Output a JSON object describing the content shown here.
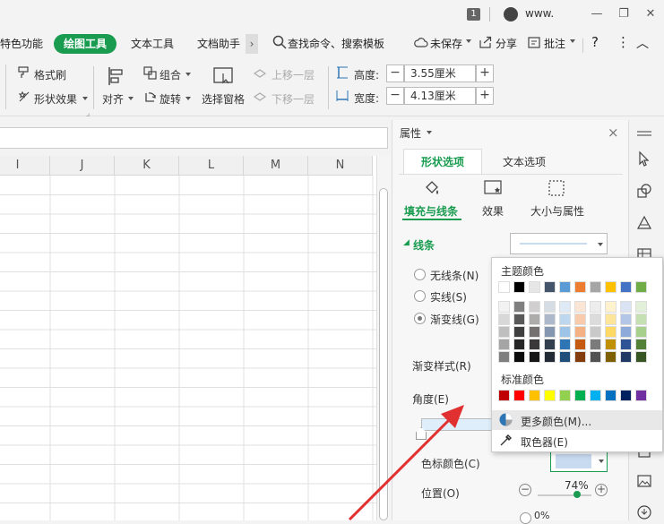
{
  "titlebar": {
    "badge": "1",
    "user": "www."
  },
  "window": {
    "minimize": "—",
    "restore": "❐",
    "close": "✕"
  },
  "menu": {
    "items": [
      "特色功能",
      "绘图工具",
      "文本工具",
      "文档助手"
    ],
    "more": "›",
    "search": "查找命令、搜索模板",
    "unsaved": "未保存",
    "share": "分享",
    "comment": "批注",
    "help": "?",
    "more_dots": "⋮",
    "collapse": "︿"
  },
  "ribbon": {
    "format_painter": "格式刷",
    "shape_effects": "形状效果",
    "align": "对齐",
    "group": "组合",
    "rotate": "旋转",
    "selection_pane": "选择窗格",
    "bring_forward": "上移一层",
    "send_backward": "下移一层",
    "height_label": "高度:",
    "height_value": "3.55厘米",
    "width_label": "宽度:",
    "width_value": "4.13厘米",
    "minus": "−",
    "plus": "+"
  },
  "sheet": {
    "columns": [
      "I",
      "J",
      "K",
      "L",
      "M",
      "N"
    ]
  },
  "panel": {
    "title": "属性",
    "close": "×",
    "tabs": [
      "形状选项",
      "文本选项"
    ],
    "subtabs": [
      "填充与线条",
      "效果",
      "大小与属性"
    ],
    "section": "线条",
    "line_options": [
      "无线条(N)",
      "实线(S)",
      "渐变线(G)"
    ],
    "gradient_style": "渐变样式(R)",
    "angle": "角度(E)",
    "stop_color": "色标颜色(C)",
    "position": "位置(O)",
    "position_value": "74%",
    "transparency_value": "0%"
  },
  "popup": {
    "theme_title": "主题颜色",
    "standard_title": "标准颜色",
    "more_colors": "更多颜色(M)...",
    "eyedropper": "取色器(E)",
    "theme_top": [
      "#ffffff",
      "#000000",
      "#e7e6e6",
      "#44546a",
      "#5b9bd5",
      "#ed7d31",
      "#a5a5a5",
      "#ffc000",
      "#4472c4",
      "#70ad47"
    ],
    "theme_shades": [
      [
        "#f2f2f2",
        "#7f7f7f",
        "#d0cece",
        "#d6dce4",
        "#deebf6",
        "#fbe5d5",
        "#ededed",
        "#fff2cc",
        "#dae3f3",
        "#e2efd9"
      ],
      [
        "#d8d8d8",
        "#595959",
        "#aeabab",
        "#adb9ca",
        "#bdd7ee",
        "#f7cbac",
        "#dbdbdb",
        "#fee599",
        "#b4c6e7",
        "#c5e0b3"
      ],
      [
        "#bfbfbf",
        "#3f3f3f",
        "#757070",
        "#8496b0",
        "#9dc3e6",
        "#f4b183",
        "#c9c9c9",
        "#ffd965",
        "#8eaadb",
        "#a8d08d"
      ],
      [
        "#a5a5a5",
        "#262626",
        "#3a3838",
        "#323f4f",
        "#2e75b5",
        "#c55a11",
        "#7b7b7b",
        "#bf9000",
        "#2f5496",
        "#538135"
      ],
      [
        "#7f7f7f",
        "#0c0c0c",
        "#171616",
        "#222a35",
        "#1e4e79",
        "#833c0b",
        "#525252",
        "#7f6000",
        "#1f3864",
        "#375623"
      ]
    ],
    "standard": [
      "#c00000",
      "#ff0000",
      "#ffc000",
      "#ffff00",
      "#92d050",
      "#00b050",
      "#00b0f0",
      "#0070c0",
      "#002060",
      "#7030a0"
    ]
  }
}
